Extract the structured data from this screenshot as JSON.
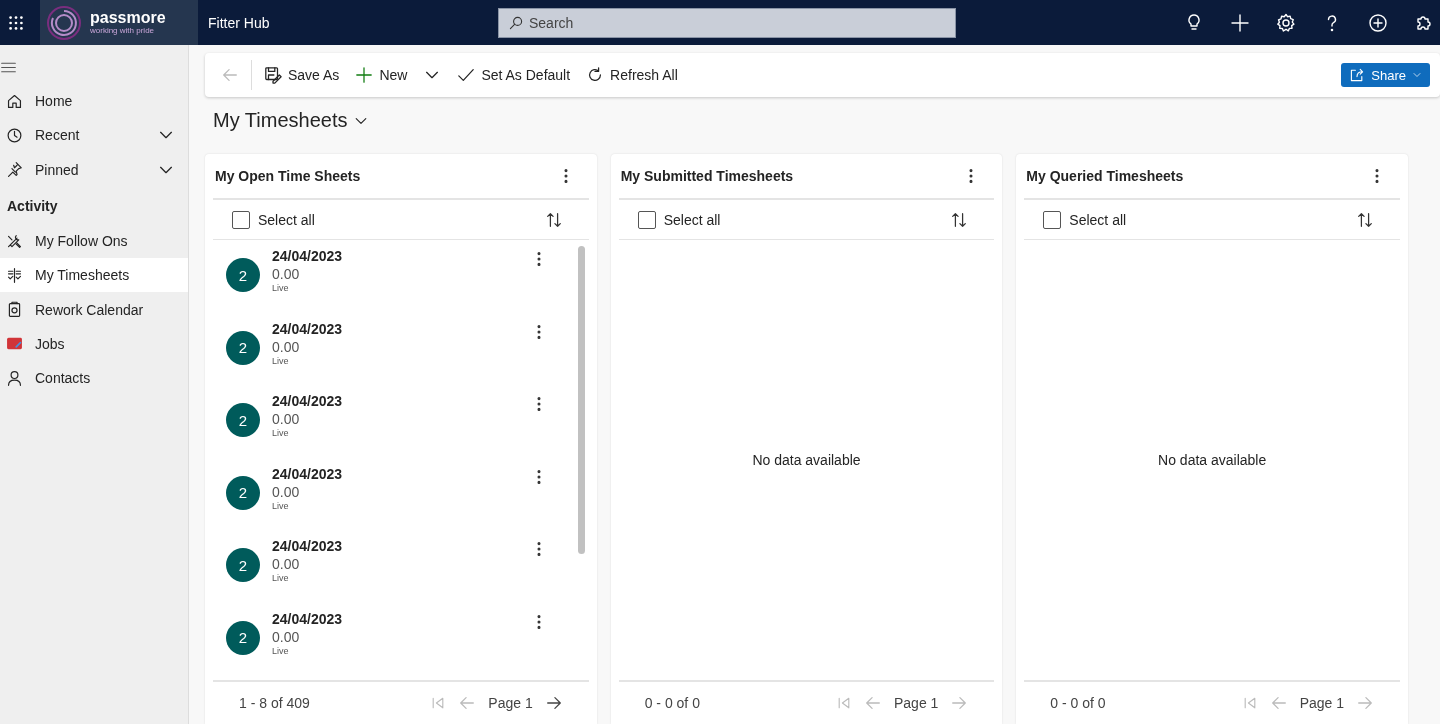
{
  "header": {
    "logo": {
      "name": "passmore",
      "tagline": "working with pride"
    },
    "app_name": "Fitter Hub",
    "search": {
      "placeholder": "Search"
    },
    "actions": [
      {
        "kind": "lightbulb"
      },
      {
        "kind": "plus"
      },
      {
        "kind": "settings"
      },
      {
        "kind": "help"
      },
      {
        "kind": "add-circle"
      },
      {
        "kind": "puzzle"
      }
    ]
  },
  "sidebar": {
    "items": [
      {
        "label": "Home",
        "kind": "home",
        "expandable": false,
        "selected": false
      },
      {
        "label": "Recent",
        "kind": "clock",
        "expandable": true,
        "selected": false
      },
      {
        "label": "Pinned",
        "kind": "pin",
        "expandable": true,
        "selected": false
      }
    ],
    "section": "Activity",
    "section_items": [
      {
        "label": "My Follow Ons",
        "kind": "tools",
        "selected": false
      },
      {
        "label": "My Timesheets",
        "kind": "timesheet",
        "selected": true
      },
      {
        "label": "Rework Calendar",
        "kind": "clipboard",
        "selected": false
      },
      {
        "label": "Jobs",
        "kind": "jobs",
        "selected": false
      },
      {
        "label": "Contacts",
        "kind": "person",
        "selected": false
      }
    ]
  },
  "command_bar": {
    "items": [
      {
        "kind": "back",
        "disabled": true
      },
      {
        "kind": "save",
        "label": "Save As",
        "disabled": false
      },
      {
        "kind": "new",
        "label": "New",
        "disabled": false
      },
      {
        "kind": "check",
        "label": "Set As Default",
        "disabled": false
      },
      {
        "kind": "refresh",
        "label": "Refresh All",
        "disabled": false
      }
    ],
    "share": {
      "label": "Share"
    }
  },
  "page_title": "My Timesheets",
  "panels": [
    {
      "title": "My Open Time Sheets",
      "select_all": {
        "label": "Select all",
        "checked": false
      },
      "records": [
        {
          "avatar": "2",
          "date": "24/04/2023",
          "amount": "0.00",
          "status": "Live"
        },
        {
          "avatar": "2",
          "date": "24/04/2023",
          "amount": "0.00",
          "status": "Live"
        },
        {
          "avatar": "2",
          "date": "24/04/2023",
          "amount": "0.00",
          "status": "Live"
        },
        {
          "avatar": "2",
          "date": "24/04/2023",
          "amount": "0.00",
          "status": "Live"
        },
        {
          "avatar": "2",
          "date": "24/04/2023",
          "amount": "0.00",
          "status": "Live"
        },
        {
          "avatar": "2",
          "date": "24/04/2023",
          "amount": "0.00",
          "status": "Live"
        }
      ],
      "range": "1 - 8 of 409",
      "page": "Page 1",
      "next_enabled": true
    },
    {
      "title": "My Submitted Timesheets",
      "select_all": {
        "label": "Select all",
        "checked": false
      },
      "empty_text": "No data available",
      "range": "0 - 0 of 0",
      "page": "Page 1",
      "next_enabled": false
    },
    {
      "title": "My Queried Timesheets",
      "select_all": {
        "label": "Select all",
        "checked": false
      },
      "empty_text": "No data available",
      "range": "0 - 0 of 0",
      "page": "Page 1",
      "next_enabled": false
    }
  ]
}
